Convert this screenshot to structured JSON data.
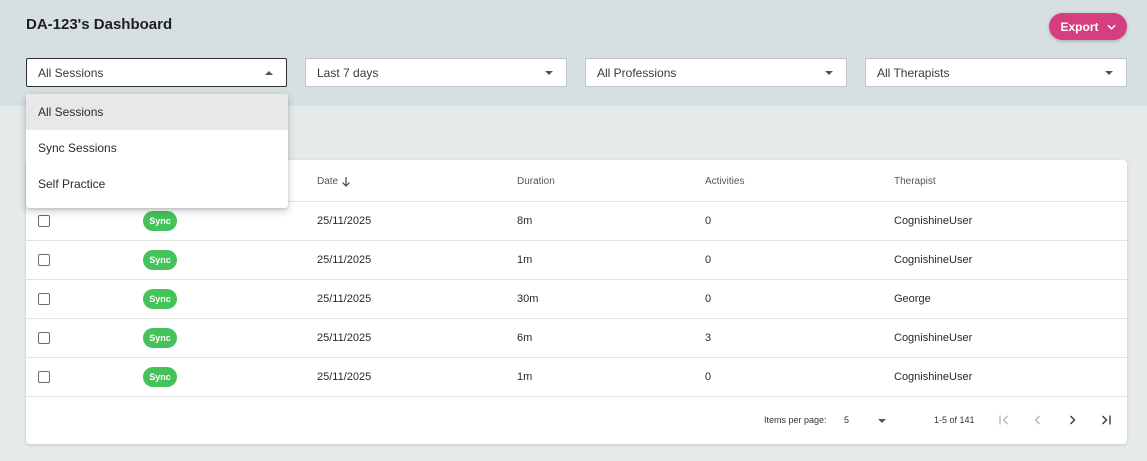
{
  "header": {
    "title": "DA-123's Dashboard",
    "export_label": "Export"
  },
  "filters": [
    {
      "value": "All Sessions",
      "open": true
    },
    {
      "value": "Last 7 days"
    },
    {
      "value": "All Professions"
    },
    {
      "value": "All Therapists"
    }
  ],
  "dropdown": {
    "options": [
      "All Sessions",
      "Sync Sessions",
      "Self Practice"
    ],
    "selected": "All Sessions"
  },
  "table": {
    "columns": [
      "Date",
      "Duration",
      "Activities",
      "Therapist"
    ],
    "sort_column": "Date",
    "sort_direction": "desc",
    "rows": [
      {
        "type": "Sync",
        "date": "25/11/2025",
        "duration": "8m",
        "activities": "0",
        "therapist": "CognishineUser"
      },
      {
        "type": "Sync",
        "date": "25/11/2025",
        "duration": "1m",
        "activities": "0",
        "therapist": "CognishineUser"
      },
      {
        "type": "Sync",
        "date": "25/11/2025",
        "duration": "30m",
        "activities": "0",
        "therapist": "George"
      },
      {
        "type": "Sync",
        "date": "25/11/2025",
        "duration": "6m",
        "activities": "3",
        "therapist": "CognishineUser"
      },
      {
        "type": "Sync",
        "date": "25/11/2025",
        "duration": "1m",
        "activities": "0",
        "therapist": "CognishineUser"
      }
    ]
  },
  "pagination": {
    "items_per_page_label": "Items per page:",
    "items_per_page": "5",
    "range": "1-5 of 141"
  },
  "colors": {
    "header_bg": "#d6dfe1",
    "page_bg": "#e6eaeb",
    "accent": "#d63f7f",
    "badge_green": "#45c25a"
  }
}
